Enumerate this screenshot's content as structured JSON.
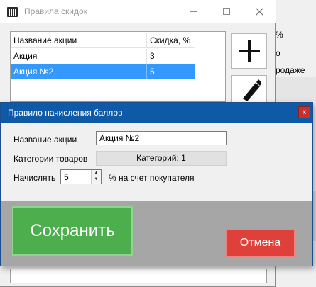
{
  "background_app": {
    "text_1": "%",
    "text_2": "о",
    "text_3": "родаже"
  },
  "main_window": {
    "title": "Правила скидок",
    "app_icon": "barcode-icon",
    "controls": {
      "minimize_icon": "minimize-icon",
      "maximize_icon": "maximize-icon",
      "close_icon": "close-icon"
    },
    "table": {
      "columns": [
        "Название акции",
        "Скидка, %"
      ],
      "rows": [
        {
          "name": "Акция",
          "discount": "3",
          "selected": false
        },
        {
          "name": "Акция №2",
          "discount": "5",
          "selected": true
        }
      ]
    },
    "side_buttons": {
      "add_icon": "plus-icon",
      "edit_icon": "pencil-icon"
    }
  },
  "dialog": {
    "title": "Правило начисления баллов",
    "close_label": "x",
    "fields": {
      "name_label": "Название акции",
      "name_value": "Акция №2",
      "categories_label": "Категории товаров",
      "categories_button": "Категорий: 1",
      "accrue_label": "Начислять",
      "accrue_value": "5",
      "accrue_suffix": "% на счет покупателя"
    },
    "buttons": {
      "save": "Сохранить",
      "cancel": "Отмена"
    }
  },
  "colors": {
    "dialog_title_bg": "#0e5aa6",
    "selection": "#3399ff",
    "save_button": "#4cae4c",
    "cancel_button": "#e0403a",
    "close_button": "#c8302c"
  }
}
